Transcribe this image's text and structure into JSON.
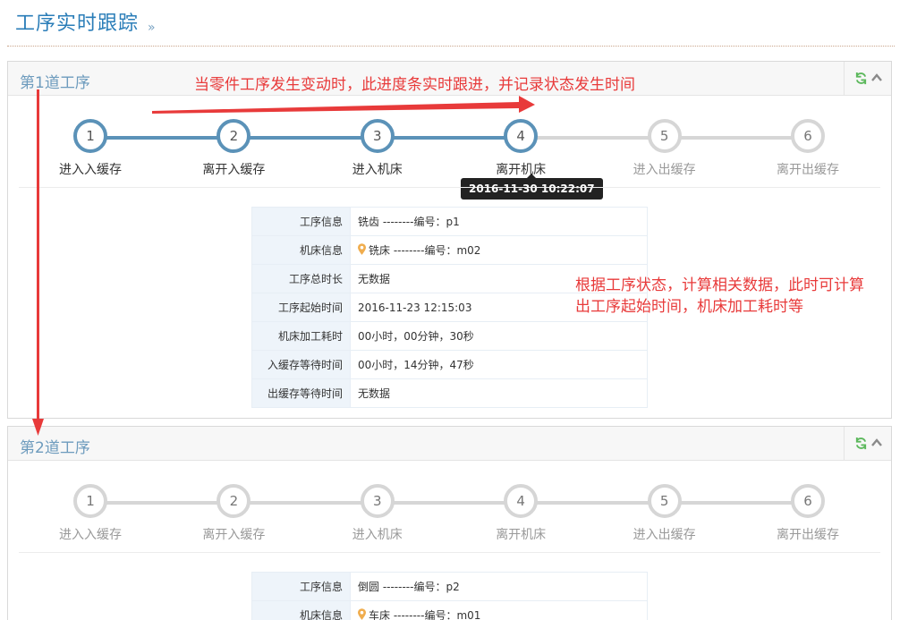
{
  "page": {
    "title": "工序实时跟踪",
    "title_chevron": "»"
  },
  "annotations": {
    "progress_note": "当零件工序发生变动时，此进度条实时跟进，并记录状态发生时间",
    "data_note_line1": "根据工序状态，计算相关数据，此时可计算",
    "data_note_line2": "出工序起始时间，机床加工耗时等",
    "color": "#e83a3a"
  },
  "colors": {
    "accent": "#5b92b8",
    "inactive": "#d6d6d6",
    "title": "#2a7db8",
    "refresh_icon": "#5cb85c"
  },
  "panels": [
    {
      "title": "第1道工序",
      "steps": [
        {
          "num": "1",
          "label": "进入入缓存",
          "done": true
        },
        {
          "num": "2",
          "label": "离开入缓存",
          "done": true
        },
        {
          "num": "3",
          "label": "进入机床",
          "done": true
        },
        {
          "num": "4",
          "label": "离开机床",
          "done": true
        },
        {
          "num": "5",
          "label": "进入出缓存",
          "done": false
        },
        {
          "num": "6",
          "label": "离开出缓存",
          "done": false
        }
      ],
      "progress_fraction": 0.6,
      "tooltip": "2016-11-30 10:22:07",
      "info": [
        {
          "key": "工序信息",
          "value": "铣齿 --------编号：p1",
          "pin": false
        },
        {
          "key": "机床信息",
          "value": "铣床 --------编号：m02",
          "pin": true
        },
        {
          "key": "工序总时长",
          "value": "无数据",
          "pin": false
        },
        {
          "key": "工序起始时间",
          "value": "2016-11-23 12:15:03",
          "pin": false
        },
        {
          "key": "机床加工耗时",
          "value": "00小时，00分钟，30秒",
          "pin": false
        },
        {
          "key": "入缓存等待时间",
          "value": "00小时，14分钟，47秒",
          "pin": false
        },
        {
          "key": "出缓存等待时间",
          "value": "无数据",
          "pin": false
        }
      ]
    },
    {
      "title": "第2道工序",
      "steps": [
        {
          "num": "1",
          "label": "进入入缓存",
          "done": false
        },
        {
          "num": "2",
          "label": "离开入缓存",
          "done": false
        },
        {
          "num": "3",
          "label": "进入机床",
          "done": false
        },
        {
          "num": "4",
          "label": "离开机床",
          "done": false
        },
        {
          "num": "5",
          "label": "进入出缓存",
          "done": false
        },
        {
          "num": "6",
          "label": "离开出缓存",
          "done": false
        }
      ],
      "progress_fraction": 0,
      "info": [
        {
          "key": "工序信息",
          "value": "倒圆 --------编号：p2",
          "pin": false
        },
        {
          "key": "机床信息",
          "value": "车床 --------编号：m01",
          "pin": true
        }
      ]
    }
  ]
}
